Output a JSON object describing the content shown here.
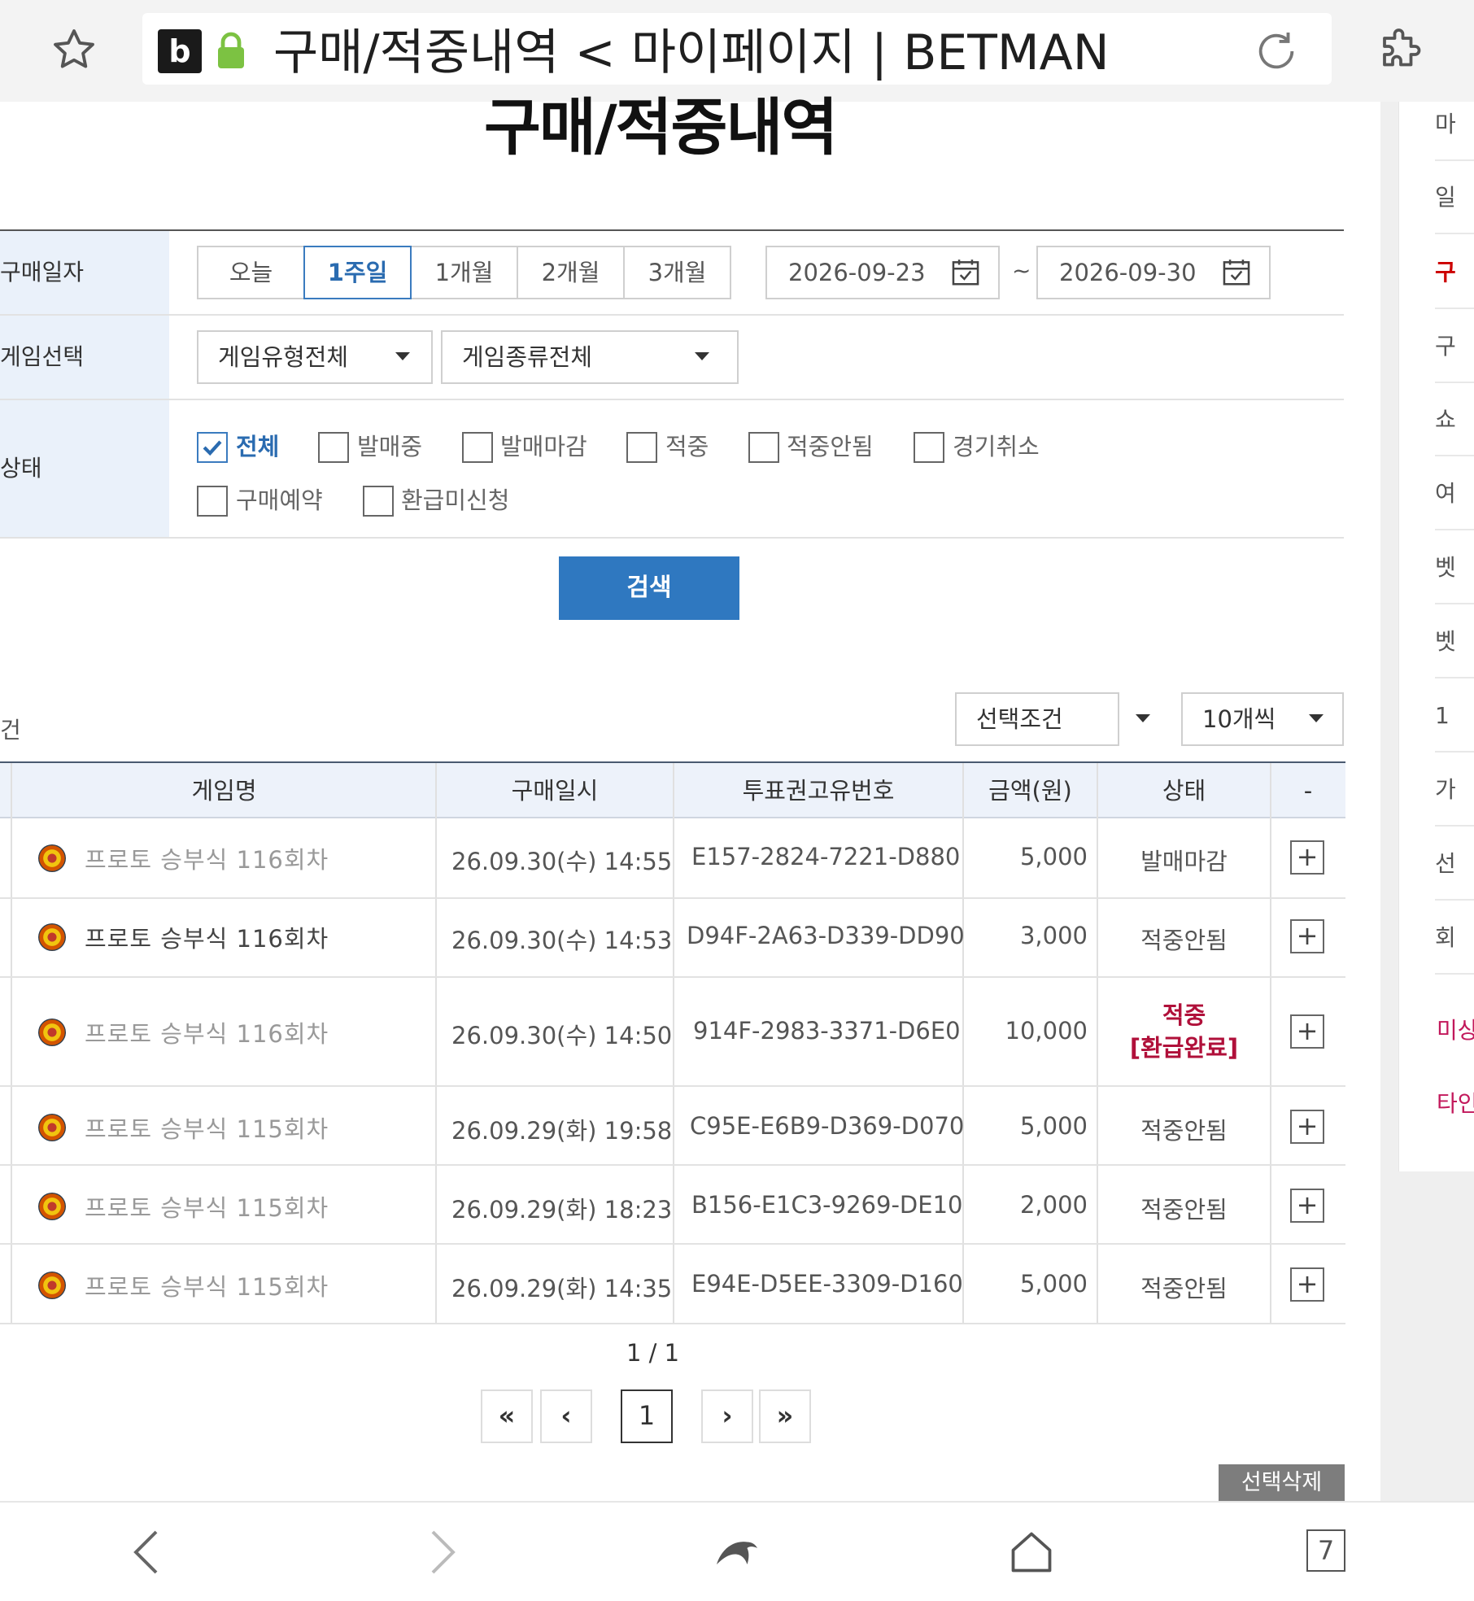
{
  "browser": {
    "logo_letter": "b",
    "title": "구매/적중내역 < 마이페이지 | BETMAN",
    "tab_count": "7"
  },
  "side_menu": {
    "items": [
      "마",
      "일",
      "구",
      "구",
      "쇼",
      "여",
      "벳",
      "벳",
      "1",
      "가",
      "선",
      "회"
    ],
    "links": [
      "미상",
      "타인"
    ]
  },
  "page": {
    "heading": "구매/적중내역"
  },
  "filters": {
    "purchase_date_label": "구매일자",
    "periods": [
      "오늘",
      "1주일",
      "1개월",
      "2개월",
      "3개월"
    ],
    "selected_period": "1주일",
    "date_from": "2026-09-23",
    "date_separator": "~",
    "date_to": "2026-09-30",
    "game_select_label": "게임선택",
    "game_type": "게임유형전체",
    "game_kind": "게임종류전체",
    "status_label": "상태",
    "status_options": [
      {
        "label": "전체",
        "checked": true
      },
      {
        "label": "발매중",
        "checked": false
      },
      {
        "label": "발매마감",
        "checked": false
      },
      {
        "label": "적중",
        "checked": false
      },
      {
        "label": "적중안됨",
        "checked": false
      },
      {
        "label": "경기취소",
        "checked": false
      },
      {
        "label": "구매예약",
        "checked": false
      },
      {
        "label": "환급미신청",
        "checked": false
      }
    ],
    "search_label": "검색"
  },
  "results": {
    "count_suffix": "건",
    "condition_select": "선택조건",
    "page_size_select": "10개씩",
    "columns": [
      "게임명",
      "구매일시",
      "투표권고유번호",
      "금액(원)",
      "상태",
      "-"
    ],
    "rows": [
      {
        "game": "프로토 승부식 116회차",
        "datetime": "26.09.30(수) 14:55",
        "ticket": "E157-2824-7221-D880",
        "amount": "5,000",
        "status": "발매마감",
        "status2": ""
      },
      {
        "game": "프로토 승부식 116회차",
        "datetime": "26.09.30(수) 14:53",
        "ticket": "D94F-2A63-D339-DD90",
        "amount": "3,000",
        "status": "적중안됨",
        "status2": ""
      },
      {
        "game": "프로토 승부식 116회차",
        "datetime": "26.09.30(수) 14:50",
        "ticket": "914F-2983-3371-D6E0",
        "amount": "10,000",
        "status": "적중",
        "status2": "[환급완료]"
      },
      {
        "game": "프로토 승부식 115회차",
        "datetime": "26.09.29(화) 19:58",
        "ticket": "C95E-E6B9-D369-D070",
        "amount": "5,000",
        "status": "적중안됨",
        "status2": ""
      },
      {
        "game": "프로토 승부식 115회차",
        "datetime": "26.09.29(화) 18:23",
        "ticket": "B156-E1C3-9269-DE10",
        "amount": "2,000",
        "status": "적중안됨",
        "status2": ""
      },
      {
        "game": "프로토 승부식 115회차",
        "datetime": "26.09.29(화) 14:35",
        "ticket": "E94E-D5EE-3309-D160",
        "amount": "5,000",
        "status": "적중안됨",
        "status2": ""
      }
    ],
    "expand_symbol": "+",
    "page_count": "1 / 1",
    "pagination": {
      "first": "«",
      "prev": "‹",
      "current": "1",
      "next": "›",
      "last": "»"
    },
    "delete_selected": "선택삭제"
  },
  "colors": {
    "accent_blue": "#2f78c0",
    "hit_red": "#b0103a",
    "label_bg": "#eaf1fa"
  }
}
